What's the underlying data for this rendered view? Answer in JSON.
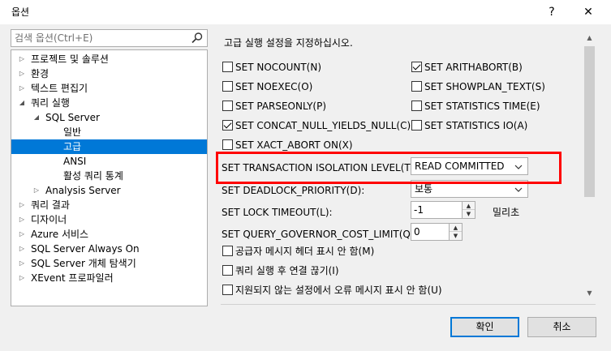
{
  "window": {
    "title": "옵션",
    "help_glyph": "?",
    "close_glyph": "✕"
  },
  "search": {
    "placeholder": "검색 옵션(Ctrl+E)",
    "icon": "search-icon"
  },
  "tree": {
    "items": [
      {
        "label": "프로젝트 및 솔루션",
        "arrow": "▷"
      },
      {
        "label": "환경",
        "arrow": "▷"
      },
      {
        "label": "텍스트 편집기",
        "arrow": "▷"
      },
      {
        "label": "쿼리 실행",
        "arrow": "◢"
      },
      {
        "label": "SQL Server",
        "arrow": "◢"
      },
      {
        "label": "일반",
        "arrow": ""
      },
      {
        "label": "고급",
        "arrow": "",
        "selected": true
      },
      {
        "label": "ANSI",
        "arrow": ""
      },
      {
        "label": "활성 쿼리 통계",
        "arrow": ""
      },
      {
        "label": "Analysis Server",
        "arrow": "▷"
      },
      {
        "label": "쿼리 결과",
        "arrow": "▷"
      },
      {
        "label": "디자이너",
        "arrow": "▷"
      },
      {
        "label": "Azure 서비스",
        "arrow": "▷"
      },
      {
        "label": "SQL Server Always On",
        "arrow": "▷"
      },
      {
        "label": "SQL Server 개체 탐색기",
        "arrow": "▷"
      },
      {
        "label": "XEvent 프로파일러",
        "arrow": "▷"
      }
    ]
  },
  "settings": {
    "heading": "고급 실행 설정을 지정하십시오.",
    "left_checks": [
      {
        "label": "SET NOCOUNT(N)",
        "checked": false
      },
      {
        "label": "SET NOEXEC(O)",
        "checked": false
      },
      {
        "label": "SET PARSEONLY(P)",
        "checked": false
      },
      {
        "label": "SET CONCAT_NULL_YIELDS_NULL(C)",
        "checked": true
      },
      {
        "label": "SET XACT_ABORT ON(X)",
        "checked": false
      }
    ],
    "right_checks": [
      {
        "label": "SET ARITHABORT(B)",
        "checked": true
      },
      {
        "label": "SET SHOWPLAN_TEXT(S)",
        "checked": false
      },
      {
        "label": "SET STATISTICS TIME(E)",
        "checked": false
      },
      {
        "label": "SET STATISTICS IO(A)",
        "checked": false
      }
    ],
    "isolation": {
      "label": "SET TRANSACTION ISOLATION LEVEL(T):",
      "value": "READ COMMITTED"
    },
    "deadlock": {
      "label": "SET DEADLOCK_PRIORITY(D):",
      "value": "보통"
    },
    "lock_timeout": {
      "label": "SET LOCK TIMEOUT(L):",
      "value": "-1",
      "unit": "밀리초"
    },
    "query_governor": {
      "label": "SET QUERY_GOVERNOR_COST_LIMIT(Q):",
      "value": "0"
    },
    "bottom_checks": [
      {
        "label": "공급자 메시지 헤더 표시 안 함(M)",
        "checked": false
      },
      {
        "label": "쿼리 실행 후 연결 끊기(I)",
        "checked": false
      },
      {
        "label": "지원되지 않는 설정에서 오류 메시지 표시 안 함(U)",
        "checked": false
      }
    ]
  },
  "buttons": {
    "ok": "확인",
    "cancel": "취소"
  },
  "colors": {
    "selection": "#0078d7",
    "highlight_box": "#ff0000"
  }
}
